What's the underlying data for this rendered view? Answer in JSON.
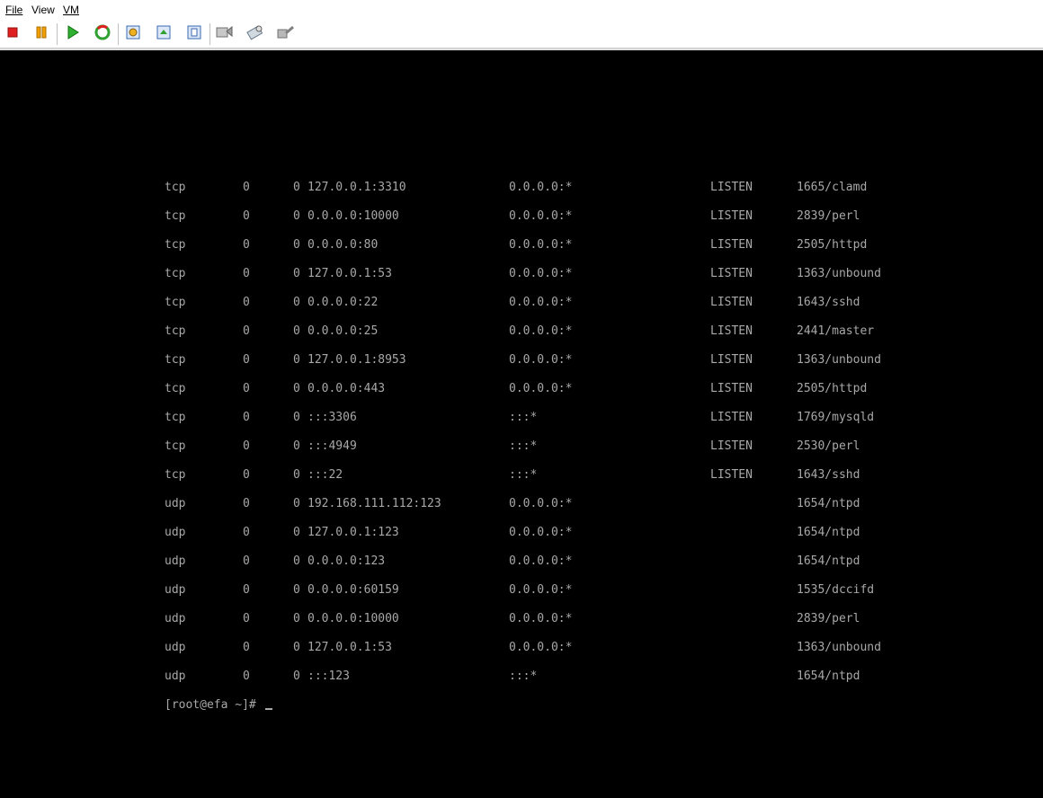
{
  "menu": [
    {
      "label": "File",
      "accel": "F",
      "rest": "ile"
    },
    {
      "label": "View",
      "accel": "V",
      "rest": "iew",
      "accel_after": "i",
      "rest2": "ew"
    },
    {
      "label": "VM",
      "accel": "VM",
      "rest": ""
    }
  ],
  "toolbar": {
    "buttons": [
      "stop-icon",
      "pause-icon",
      "play-icon",
      "reset-icon",
      "snapshot-icon",
      "snapshot-revert-icon",
      "snapshot-manager-icon",
      "vm-settings-icon",
      "edit-settings-icon",
      "tools-icon"
    ]
  },
  "terminal": {
    "rows": [
      {
        "proto": "tcp",
        "recv": "0",
        "send": "0",
        "local": "127.0.0.1:3310",
        "foreign": "0.0.0.0:*",
        "state": "LISTEN",
        "pid": "1665/clamd"
      },
      {
        "proto": "tcp",
        "recv": "0",
        "send": "0",
        "local": "0.0.0.0:10000",
        "foreign": "0.0.0.0:*",
        "state": "LISTEN",
        "pid": "2839/perl"
      },
      {
        "proto": "tcp",
        "recv": "0",
        "send": "0",
        "local": "0.0.0.0:80",
        "foreign": "0.0.0.0:*",
        "state": "LISTEN",
        "pid": "2505/httpd"
      },
      {
        "proto": "tcp",
        "recv": "0",
        "send": "0",
        "local": "127.0.0.1:53",
        "foreign": "0.0.0.0:*",
        "state": "LISTEN",
        "pid": "1363/unbound"
      },
      {
        "proto": "tcp",
        "recv": "0",
        "send": "0",
        "local": "0.0.0.0:22",
        "foreign": "0.0.0.0:*",
        "state": "LISTEN",
        "pid": "1643/sshd"
      },
      {
        "proto": "tcp",
        "recv": "0",
        "send": "0",
        "local": "0.0.0.0:25",
        "foreign": "0.0.0.0:*",
        "state": "LISTEN",
        "pid": "2441/master"
      },
      {
        "proto": "tcp",
        "recv": "0",
        "send": "0",
        "local": "127.0.0.1:8953",
        "foreign": "0.0.0.0:*",
        "state": "LISTEN",
        "pid": "1363/unbound"
      },
      {
        "proto": "tcp",
        "recv": "0",
        "send": "0",
        "local": "0.0.0.0:443",
        "foreign": "0.0.0.0:*",
        "state": "LISTEN",
        "pid": "2505/httpd"
      },
      {
        "proto": "tcp",
        "recv": "0",
        "send": "0",
        "local": ":::3306",
        "foreign": ":::*",
        "state": "LISTEN",
        "pid": "1769/mysqld"
      },
      {
        "proto": "tcp",
        "recv": "0",
        "send": "0",
        "local": ":::4949",
        "foreign": ":::*",
        "state": "LISTEN",
        "pid": "2530/perl"
      },
      {
        "proto": "tcp",
        "recv": "0",
        "send": "0",
        "local": ":::22",
        "foreign": ":::*",
        "state": "LISTEN",
        "pid": "1643/sshd"
      },
      {
        "proto": "udp",
        "recv": "0",
        "send": "0",
        "local": "192.168.111.112:123",
        "foreign": "0.0.0.0:*",
        "state": "",
        "pid": "1654/ntpd"
      },
      {
        "proto": "udp",
        "recv": "0",
        "send": "0",
        "local": "127.0.0.1:123",
        "foreign": "0.0.0.0:*",
        "state": "",
        "pid": "1654/ntpd"
      },
      {
        "proto": "udp",
        "recv": "0",
        "send": "0",
        "local": "0.0.0.0:123",
        "foreign": "0.0.0.0:*",
        "state": "",
        "pid": "1654/ntpd"
      },
      {
        "proto": "udp",
        "recv": "0",
        "send": "0",
        "local": "0.0.0.0:60159",
        "foreign": "0.0.0.0:*",
        "state": "",
        "pid": "1535/dccifd"
      },
      {
        "proto": "udp",
        "recv": "0",
        "send": "0",
        "local": "0.0.0.0:10000",
        "foreign": "0.0.0.0:*",
        "state": "",
        "pid": "2839/perl"
      },
      {
        "proto": "udp",
        "recv": "0",
        "send": "0",
        "local": "127.0.0.1:53",
        "foreign": "0.0.0.0:*",
        "state": "",
        "pid": "1363/unbound"
      },
      {
        "proto": "udp",
        "recv": "0",
        "send": "0",
        "local": ":::123",
        "foreign": ":::*",
        "state": "",
        "pid": "1654/ntpd"
      }
    ],
    "prompt": "[root@efa ~]#"
  },
  "colors": {
    "console_bg": "#000000",
    "console_fg": "#a8a8a8",
    "toolbar_bg": "#ffffff"
  }
}
